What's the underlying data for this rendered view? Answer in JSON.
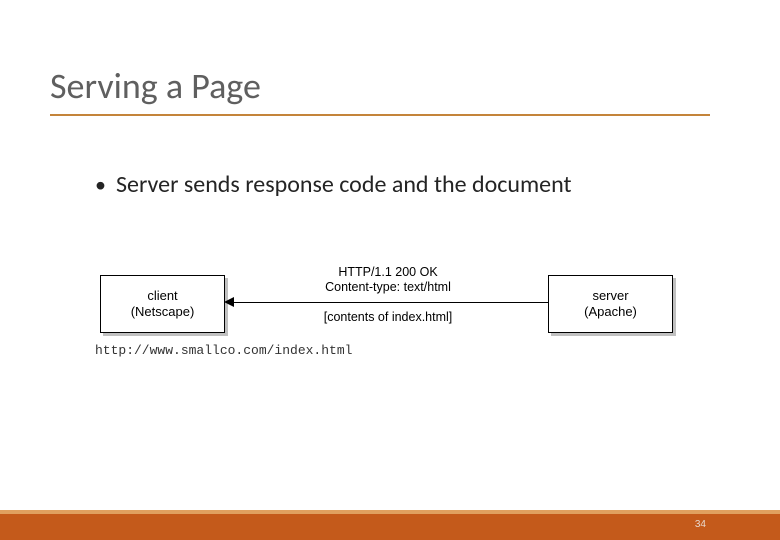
{
  "title": "Serving a Page",
  "bullet": "Server sends response code and the document",
  "diagram": {
    "client": {
      "line1": "client",
      "line2": "(Netscape)"
    },
    "server": {
      "line1": "server",
      "line2": "(Apache)"
    },
    "http_line1": "HTTP/1.1 200 OK",
    "http_line2": "Content-type: text/html",
    "contents": "[contents of index.html]",
    "url": "http://www.smallco.com/index.html"
  },
  "page_number": "34"
}
